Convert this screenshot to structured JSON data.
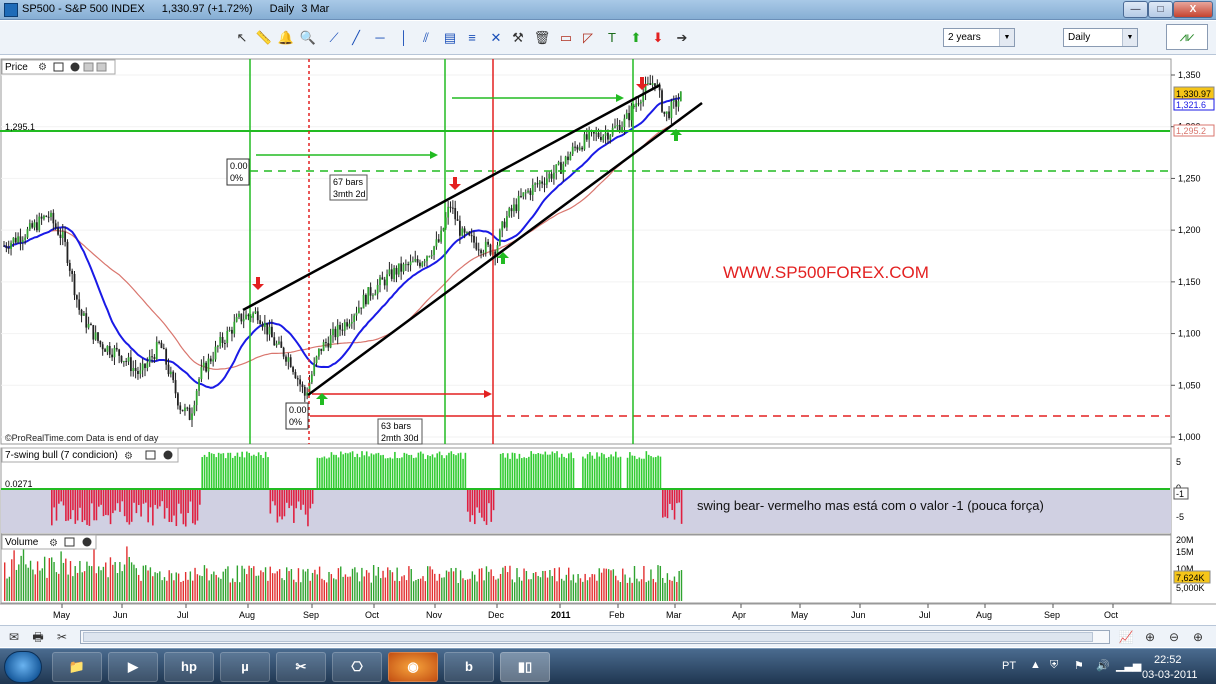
{
  "window": {
    "title": "SP500 - S&P 500 INDEX",
    "last_price": "1,330.97",
    "change": "(+1.72%)",
    "period": "Daily",
    "date": "3 Mar",
    "min_label": "—",
    "max_label": "□",
    "close_label": "X"
  },
  "toolbar": {
    "icons": [
      "pointer-icon",
      "ruler-icon",
      "alert-bell-icon",
      "zoom-icon",
      "trendline-icon",
      "line-icon",
      "horizontal-line-icon",
      "vertical-line-icon",
      "fan-icon",
      "channel-icon",
      "fibonacci-icon",
      "cross-icon",
      "tools-icon",
      "trash-icon",
      "indicator-icon",
      "pattern-icon",
      "text-tool-icon",
      "green-up-arrow-icon",
      "red-down-arrow-icon",
      "right-arrow-icon"
    ],
    "range_select": "2 years",
    "period_select": "Daily"
  },
  "price_panel": {
    "title": "Price",
    "symbol_overlay": "WWW.SP500FOREX.COM",
    "footer": "©ProRealTime.com  Data is end of day",
    "level_label": "1,295.1",
    "last_price_tag": "1,330.97",
    "ma_tag": "1,321.6",
    "ma_tag2": "1,295.2",
    "y_ticks": [
      "1,350",
      "1,300",
      "1,250",
      "1,200",
      "1,150",
      "1,100",
      "1,050",
      "1,000"
    ],
    "annotations": {
      "box1_value": "0.00",
      "box1_pct": "0%",
      "box2_value": "0.00",
      "box2_pct": "0%",
      "count1_bars": "67 bars",
      "count1_time": "3mth 2d",
      "count2_bars": "63 bars",
      "count2_time": "2mth 30d"
    },
    "colors": {
      "trend": "#000000",
      "fast_ma": "#1a1ae6",
      "slow_ma": "#d9766e",
      "up": "#22aa22",
      "down": "#e32020",
      "level": "#22bb22",
      "candle_up": "#2fa32f",
      "candle_down": "#222222"
    }
  },
  "swing_panel": {
    "title": "7-swing bull (7 condicion)",
    "value_label": "0.0271",
    "current_tag": "-1",
    "y_ticks": [
      "5",
      "0",
      "-5"
    ],
    "note": "swing bear- vermelho mas está com o valor -1 (pouca força)"
  },
  "volume_panel": {
    "title": "Volume",
    "current_tag": "7,624K",
    "y_ticks": [
      "20M",
      "15M",
      "10M",
      "5,000K"
    ]
  },
  "x_axis": {
    "months": [
      "May",
      "Jun",
      "Jul",
      "Aug",
      "Sep",
      "Oct",
      "Nov",
      "Dec",
      "2011",
      "Feb",
      "Mar",
      "Apr",
      "May",
      "Jun",
      "Jul",
      "Aug",
      "Sep",
      "Oct"
    ]
  },
  "taskbar": {
    "lang": "PT",
    "time": "22:52",
    "date": "03-03-2011"
  }
}
